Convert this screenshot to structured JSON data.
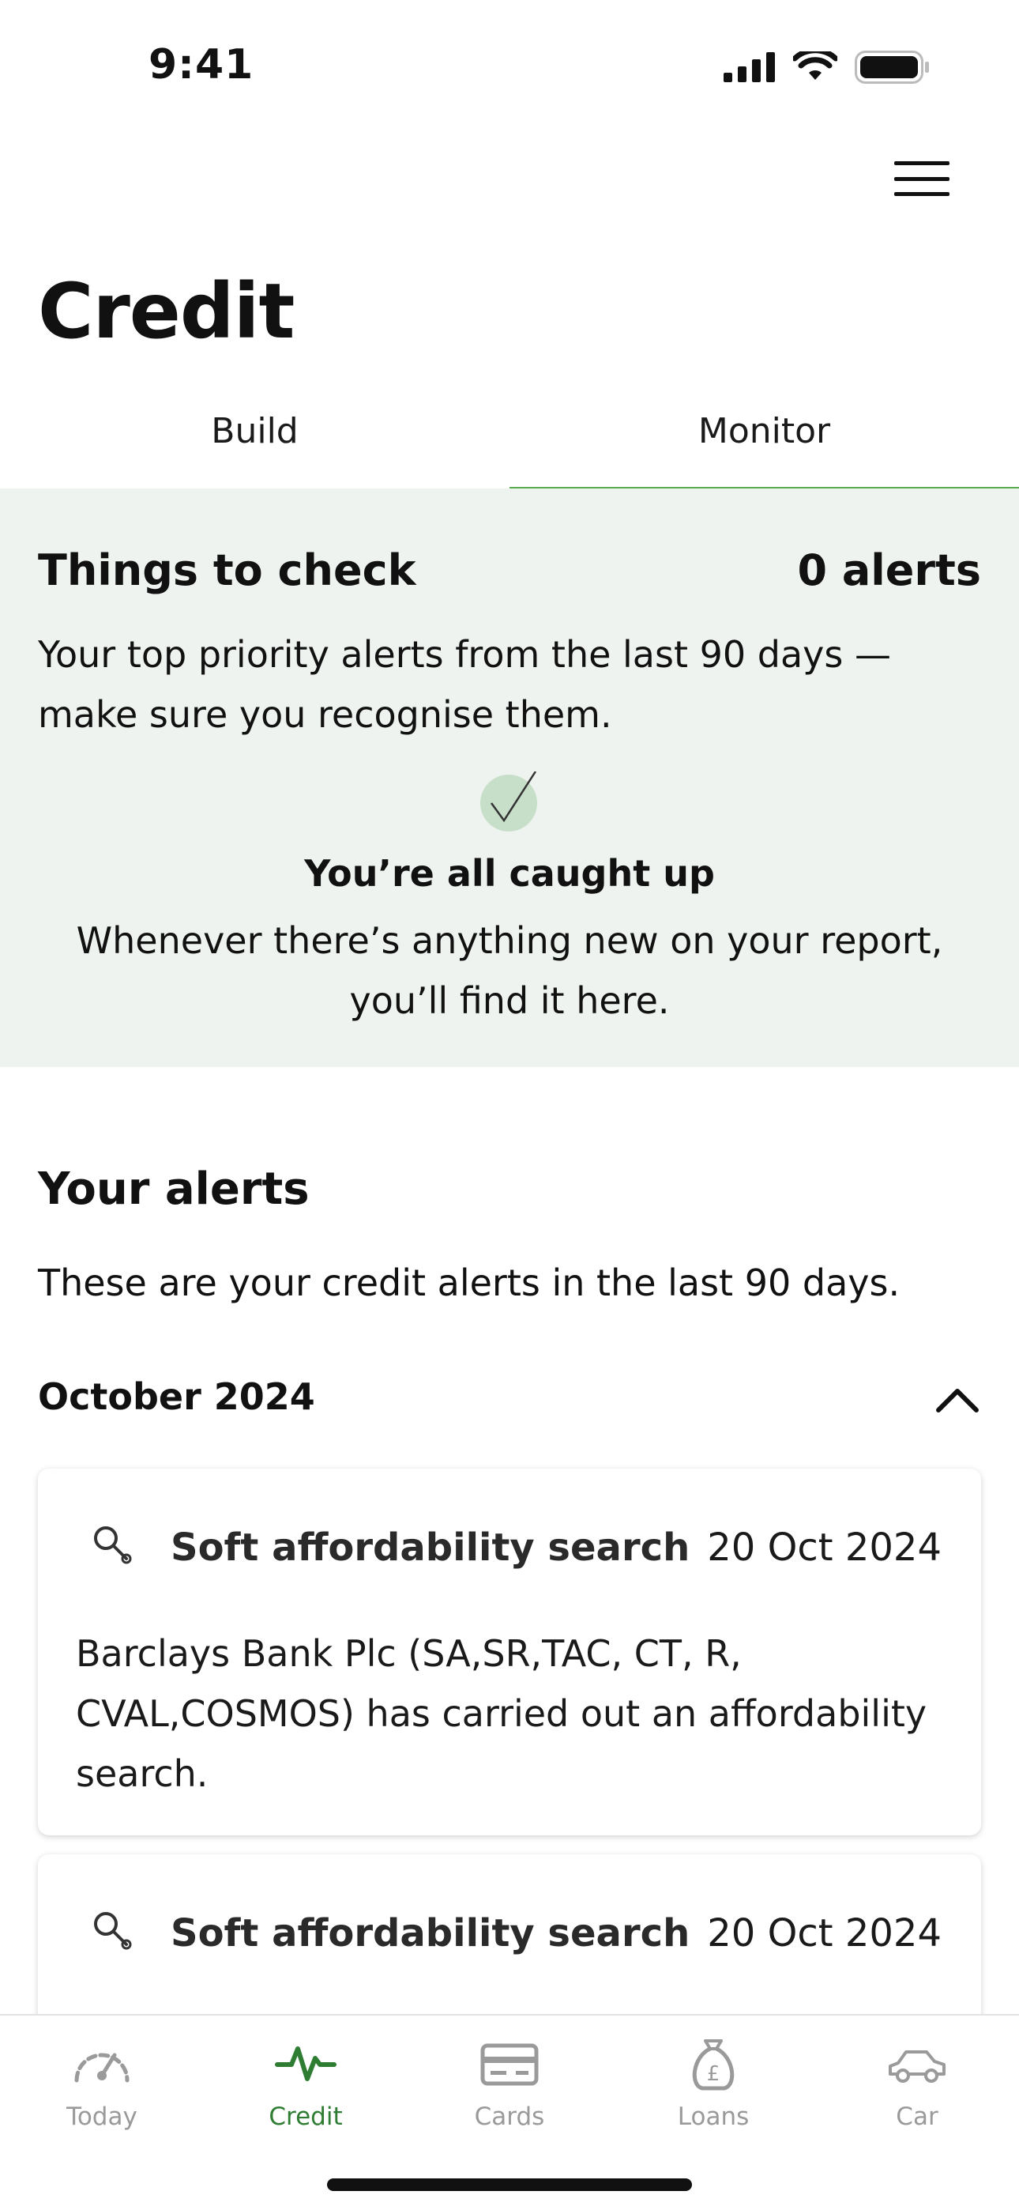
{
  "status_bar": {
    "time": "9:41"
  },
  "header": {
    "title": "Credit"
  },
  "tabs": [
    {
      "label": "Build",
      "active": false
    },
    {
      "label": "Monitor",
      "active": true
    }
  ],
  "things_to_check": {
    "title": "Things to check",
    "count": "0 alerts",
    "description": "Your top priority alerts from the last 90 days — make sure you recognise them.",
    "caught_up_title": "You’re all caught up",
    "caught_up_description": "Whenever there’s anything new on your report, you’ll find it here."
  },
  "your_alerts": {
    "title": "Your alerts",
    "description": "These are your credit alerts in the last 90 days.",
    "month": "October 2024",
    "items": [
      {
        "icon": "magnifier-icon",
        "title": "Soft affordability search",
        "date": "20 Oct 2024",
        "body": "Barclays Bank Plc (SA,SR,TAC, CT, R, CVAL,COSMOS) has carried out an affordability search."
      },
      {
        "icon": "magnifier-icon",
        "title": "Soft affordability search",
        "date": "20 Oct 2024"
      }
    ]
  },
  "bottom_nav": [
    {
      "label": "Today",
      "icon": "speedometer-icon",
      "active": false
    },
    {
      "label": "Credit",
      "icon": "pulse-icon",
      "active": true
    },
    {
      "label": "Cards",
      "icon": "card-icon",
      "active": false
    },
    {
      "label": "Loans",
      "icon": "money-bag-icon",
      "active": false
    },
    {
      "label": "Car",
      "icon": "car-icon",
      "active": false
    }
  ],
  "colors": {
    "accent": "#5aaa4f",
    "panel_bg": "#eef3ef",
    "active_nav": "#2e7d32",
    "inactive_nav": "#9a9a9a"
  }
}
